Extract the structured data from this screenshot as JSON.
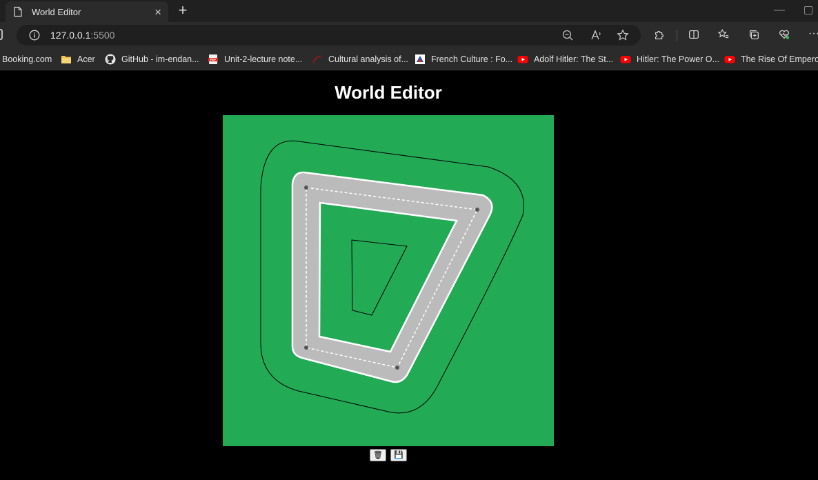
{
  "browser": {
    "tab_title": "World Editor",
    "tab_close": "×",
    "new_tab": "+",
    "url_host": "127.0.0.1",
    "url_port": ":5500"
  },
  "bookmarks": [
    {
      "label": "Booking.com",
      "icon": "booking-favicon"
    },
    {
      "label": "Acer",
      "icon": "folder-icon"
    },
    {
      "label": "GitHub - im-endan...",
      "icon": "github-icon"
    },
    {
      "label": "Unit-2-lecture note...",
      "icon": "pdf-icon"
    },
    {
      "label": "Cultural analysis of...",
      "icon": "site-favicon"
    },
    {
      "label": "French Culture : Fo...",
      "icon": "site-favicon"
    },
    {
      "label": "Adolf Hitler: The St...",
      "icon": "youtube-icon"
    },
    {
      "label": "Hitler: The Power O...",
      "icon": "youtube-icon"
    },
    {
      "label": "The Rise Of Empero...",
      "icon": "youtube-icon"
    }
  ],
  "page": {
    "title": "World Editor",
    "controls": [
      {
        "label": "🗑",
        "icon": "trash-icon"
      },
      {
        "label": "💾",
        "icon": "save-icon"
      }
    ]
  },
  "colors": {
    "canvas_bg": "#22aa55",
    "road": "#bbbbbb",
    "road_border": "#ffffff",
    "lane_marks": "#ffffff",
    "points": "#555555",
    "outline": "#000000"
  }
}
